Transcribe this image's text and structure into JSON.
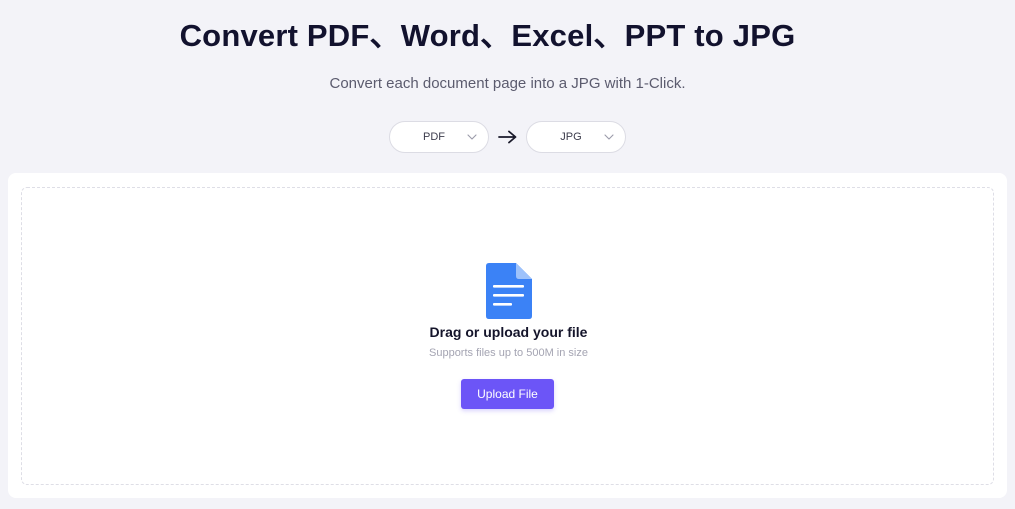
{
  "header": {
    "title": "Convert PDF、Word、Excel、PPT to JPG",
    "subtitle": "Convert each document page into a JPG with 1-Click."
  },
  "converter": {
    "from_format": "PDF",
    "to_format": "JPG",
    "arrow_icon": "arrow-right-icon",
    "chevron_icon": "chevron-down-icon"
  },
  "upload": {
    "file_icon": "document-icon",
    "title": "Drag or upload your file",
    "subtitle": "Supports files up to 500M in size",
    "button_label": "Upload File"
  },
  "colors": {
    "background": "#f3f3f8",
    "accent": "#6c55f7",
    "file_icon": "#3b82f6",
    "title_text": "#12122e"
  }
}
